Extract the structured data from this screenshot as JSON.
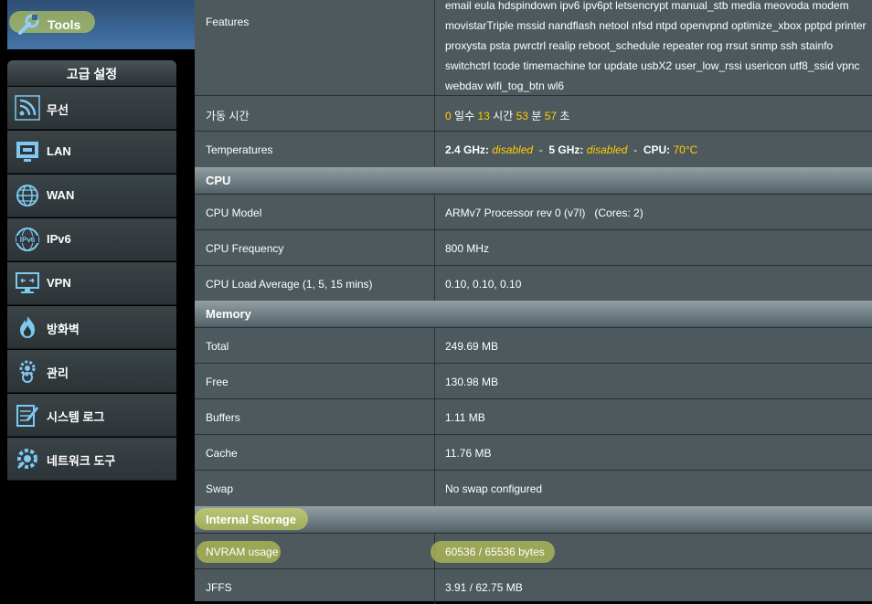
{
  "sidebar": {
    "tools_label": "Tools",
    "advanced_header": "고급 설정",
    "items": [
      {
        "label": "무선",
        "icon": "wireless-icon"
      },
      {
        "label": "LAN",
        "icon": "lan-icon"
      },
      {
        "label": "WAN",
        "icon": "wan-globe-icon"
      },
      {
        "label": "IPv6",
        "icon": "ipv6-icon"
      },
      {
        "label": "VPN",
        "icon": "vpn-icon"
      },
      {
        "label": "방화벽",
        "icon": "firewall-icon"
      },
      {
        "label": "관리",
        "icon": "admin-gear-icon"
      },
      {
        "label": "시스템 로그",
        "icon": "system-log-icon"
      },
      {
        "label": "네트워크 도구",
        "icon": "network-tools-icon"
      }
    ]
  },
  "features": {
    "label": "Features",
    "value": "email eula hdspindown ipv6 ipv6pt letsencrypt manual_stb media meovoda modem movistarTriple mssid nandflash netool nfsd ntpd openvpnd optimize_xbox pptpd printer proxysta psta pwrctrl realip reboot_schedule repeater rog rrsut snmp ssh stainfo switchctrl tcode timemachine tor update usbX2 user_low_rssi usericon utf8_ssid vpnc webdav wifi_tog_btn wl6"
  },
  "uptime": {
    "label": "가동 시간",
    "days": "0",
    "days_unit": "일수",
    "hours": "13",
    "hours_unit": "시간",
    "minutes": "53",
    "minutes_unit": "분",
    "seconds": "57",
    "seconds_unit": "초"
  },
  "temperatures": {
    "label": "Temperatures",
    "g24_label": "2.4 GHz:",
    "g24_value": "disabled",
    "sep": "-",
    "g5_label": "5 GHz:",
    "g5_value": "disabled",
    "cpu_label": "CPU:",
    "cpu_value": "70°C"
  },
  "cpu": {
    "section": "CPU",
    "model_label": "CPU Model",
    "model_value": "ARMv7 Processor rev 0 (v7l)   (Cores: 2)",
    "freq_label": "CPU Frequency",
    "freq_value": "800 MHz",
    "load_label": "CPU Load Average (1, 5, 15 mins)",
    "load_value": "0.10, 0.10, 0.10"
  },
  "memory": {
    "section": "Memory",
    "rows": [
      {
        "label": "Total",
        "value": "249.69 MB"
      },
      {
        "label": "Free",
        "value": "130.98 MB"
      },
      {
        "label": "Buffers",
        "value": "1.11 MB"
      },
      {
        "label": "Cache",
        "value": "11.76 MB"
      },
      {
        "label": "Swap",
        "value": "No swap configured"
      }
    ]
  },
  "storage": {
    "section": "Internal Storage",
    "nvram_label": "NVRAM usage",
    "nvram_value": "60536 / 65536 bytes",
    "jffs_label": "JFFS",
    "jffs_value": "3.91 / 62.75 MB"
  },
  "colors": {
    "accent_yellow": "#ffcc00",
    "panel": "#4d595d",
    "highlight": "#dce650"
  }
}
